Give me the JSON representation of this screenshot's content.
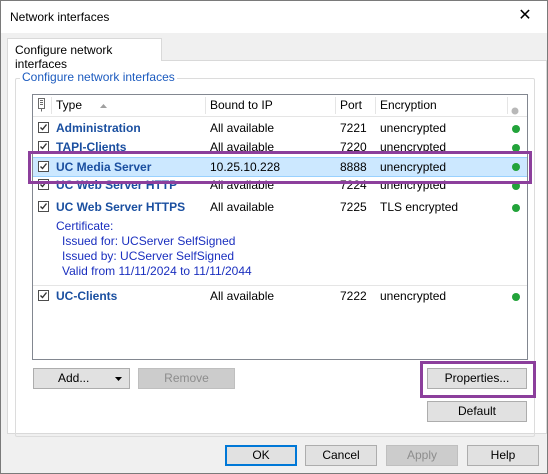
{
  "window": {
    "title": "Network interfaces"
  },
  "tabs": [
    {
      "label": "Configure network interfaces"
    }
  ],
  "group": {
    "label": "Configure network interfaces"
  },
  "table": {
    "columns": {
      "icon": "network-icon",
      "type": "Type",
      "bound": "Bound to IP",
      "port": "Port",
      "encryption": "Encryption",
      "status": "status-dot-icon"
    },
    "rows": [
      {
        "checked": true,
        "type": "Administration",
        "bound": "All available",
        "port": "7221",
        "encryption": "unencrypted",
        "status_color": "#22a33a"
      },
      {
        "checked": true,
        "type": "TAPI-Clients",
        "bound": "All available",
        "port": "7220",
        "encryption": "unencrypted",
        "status_color": "#22a33a"
      },
      {
        "checked": true,
        "type": "UC Media Server",
        "bound": "10.25.10.228",
        "port": "8888",
        "encryption": "unencrypted",
        "status_color": "#22a33a",
        "selected": true
      },
      {
        "checked": true,
        "type": "UC Web Server HTTP",
        "bound": "All available",
        "port": "7224",
        "encryption": "unencrypted",
        "status_color": "#22a33a"
      },
      {
        "checked": true,
        "type": "UC Web Server HTTPS",
        "bound": "All available",
        "port": "7225",
        "encryption": "TLS encrypted",
        "status_color": "#22a33a"
      },
      {
        "checked": true,
        "type": "UC-Clients",
        "bound": "All available",
        "port": "7222",
        "encryption": "unencrypted",
        "status_color": "#22a33a"
      }
    ],
    "certificate": {
      "heading": "Certificate:",
      "issued_for": "Issued for: UCServer SelfSigned",
      "issued_by": "Issued by: UCServer SelfSigned",
      "valid": "Valid from 11/11/2024 to 11/11/2044"
    }
  },
  "buttons": {
    "add": "Add...",
    "remove": "Remove",
    "properties": "Properties...",
    "default": "Default",
    "ok": "OK",
    "cancel": "Cancel",
    "apply": "Apply",
    "help": "Help"
  },
  "colors": {
    "accent": "#1c5bbf",
    "highlight": "#8c3f9c",
    "selection": "#cce8ff",
    "status_ok": "#22a33a"
  }
}
